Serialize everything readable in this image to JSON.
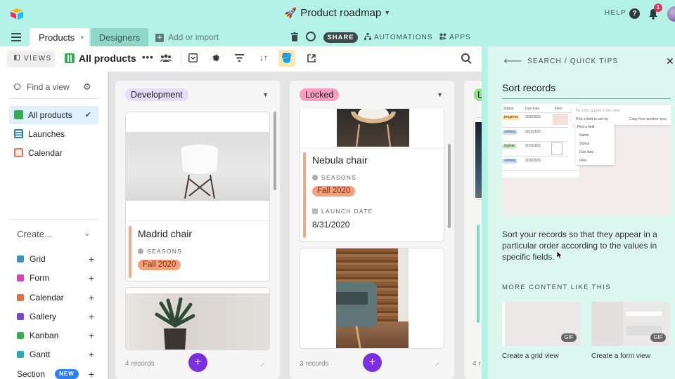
{
  "topbar": {
    "base_title": "Product roadmap",
    "base_emoji": "🚀",
    "help_label": "HELP",
    "notification_count": "1"
  },
  "tabs": {
    "items": [
      {
        "label": "Products",
        "active": true
      },
      {
        "label": "Designers",
        "active": false
      }
    ],
    "add_label": "Add or import",
    "share_label": "SHARE",
    "automations_label": "AUTOMATIONS",
    "apps_label": "APPS"
  },
  "toolbar": {
    "views_label": "VIEWS",
    "view_name": "All products",
    "more": "•••"
  },
  "sidebar": {
    "find_placeholder": "Find a view",
    "views": [
      {
        "label": "All products",
        "type": "kanban",
        "selected": true
      },
      {
        "label": "Launches",
        "type": "grid",
        "selected": false
      },
      {
        "label": "Calendar",
        "type": "calendar",
        "selected": false
      }
    ],
    "create_label": "Create...",
    "create_items": [
      {
        "label": "Grid",
        "color": "#2d7ff9"
      },
      {
        "label": "Form",
        "color": "#e929ba"
      },
      {
        "label": "Calendar",
        "color": "#f7653b"
      },
      {
        "label": "Gallery",
        "color": "#8b46ff"
      },
      {
        "label": "Kanban",
        "color": "#20c933"
      },
      {
        "label": "Gantt",
        "color": "#18bfff"
      },
      {
        "label": "Section",
        "color": ""
      }
    ],
    "new_badge": "NEW"
  },
  "board": {
    "columns": [
      {
        "name": "Development",
        "pill_color": "#e7dcfb",
        "records": "4 records",
        "cards": [
          {
            "title": "Madrid chair",
            "seasons_label": "SEASONS",
            "season": "Fall 2020"
          }
        ]
      },
      {
        "name": "Locked",
        "pill_color": "#f99cc0",
        "records": "3 records",
        "cards": [
          {
            "title": "Nebula chair",
            "seasons_label": "SEASONS",
            "season": "Fall 2020",
            "launch_label": "LAUNCH DATE",
            "launch_date": "8/31/2020"
          }
        ]
      },
      {
        "name": "L",
        "pill_color": "#93e088",
        "records": "4 r"
      }
    ]
  },
  "panel": {
    "breadcrumb": "SEARCH / QUICK TIPS",
    "tip_title": "Sort records",
    "tip_description": "Sort your records so that they appear in a particular order according to the values in specific fields.",
    "more_label": "MORE CONTENT LIKE THIS",
    "related": [
      {
        "caption": "Create a grid view",
        "badge": "GIF"
      },
      {
        "caption": "Create a form view",
        "badge": "GIF"
      }
    ],
    "preview": {
      "headers": [
        "Status",
        "Due date",
        "Files"
      ],
      "rows": [
        {
          "status": "progress",
          "date": "3/26/2021"
        },
        {
          "status": "coming",
          "date": "3/31/2021"
        },
        {
          "status": "mplete",
          "date": "3/19/2021"
        },
        {
          "status": "coming",
          "date": "3/30/2021"
        }
      ],
      "no_sorts": "No sorts applied to this view",
      "pick_field": "Pick a field to sort by",
      "copy": "Copy from another view",
      "find_field": "Find a field",
      "fields": [
        "Name",
        "Status",
        "Due date",
        "Files"
      ]
    }
  }
}
